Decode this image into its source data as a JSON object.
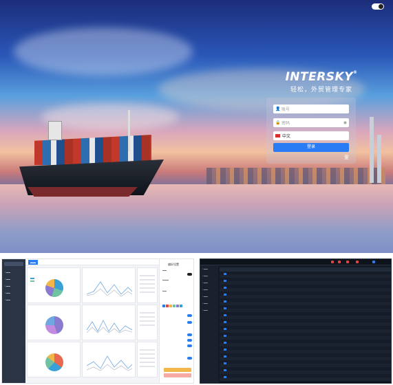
{
  "theme_toggle": {
    "state": "dark-mode-toggle"
  },
  "brand": {
    "logo": "INTERSKY",
    "slogan": "轻松，外贸管理专家"
  },
  "login": {
    "account_placeholder": "账号",
    "password_placeholder": "密码",
    "language": "中文",
    "submit_label": "登录",
    "aside_label": "爱"
  },
  "colors": {
    "accent": "#2a7cf5",
    "sidebar_light": "#2b3444",
    "dark_bg": "#141a24"
  },
  "icons": [
    "user-icon",
    "lock-icon",
    "eye-icon",
    "flag-icon",
    "theme-toggle-icon"
  ],
  "preview_light": {
    "drawer_title": "偏好设置",
    "primary_button_color": "#f2b84b",
    "secondary_button_color": "#f7a9a3"
  },
  "preview_dark": {
    "accent": "#2a7cf5"
  }
}
